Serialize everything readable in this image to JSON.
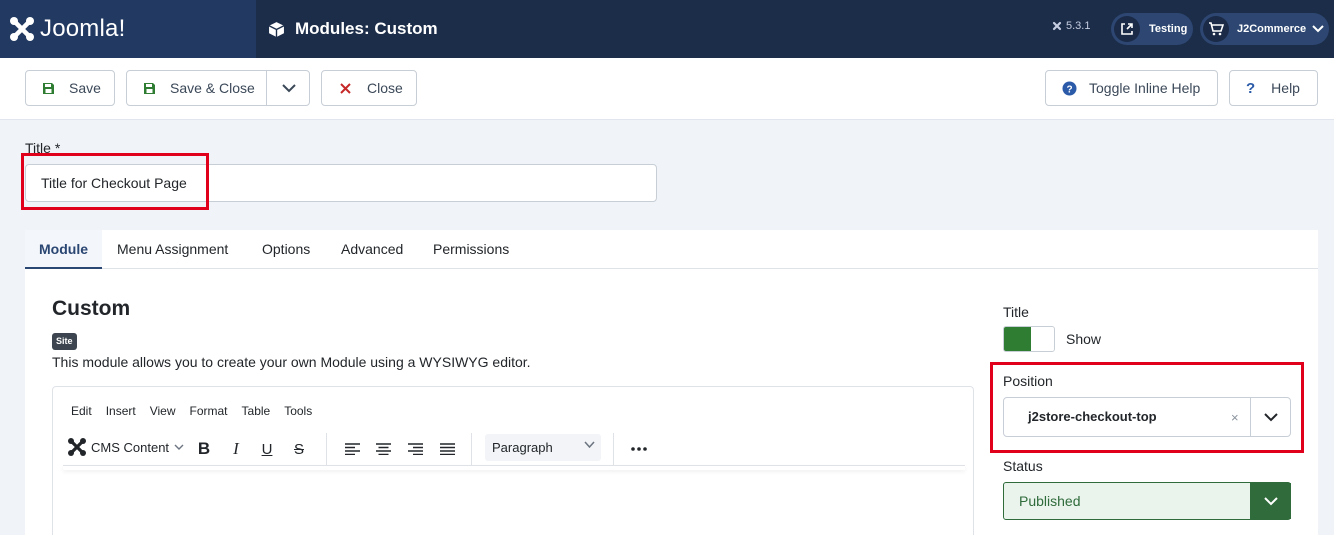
{
  "header": {
    "logo_text": "Joomla!",
    "page_title": "Modules: Custom",
    "version": "5.3.1",
    "site_button": "Testing",
    "user_menu": "J2Commerce"
  },
  "toolbar": {
    "save": "Save",
    "save_close": "Save & Close",
    "close": "Close",
    "toggle_help": "Toggle Inline Help",
    "help": "Help"
  },
  "title_field": {
    "label": "Title *",
    "value": "Title for Checkout Page"
  },
  "tabs": [
    "Module",
    "Menu Assignment",
    "Options",
    "Advanced",
    "Permissions"
  ],
  "module": {
    "name": "Custom",
    "badge": "Site",
    "description": "This module allows you to create your own Module using a WYSIWYG editor."
  },
  "editor": {
    "menu": [
      "Edit",
      "Insert",
      "View",
      "Format",
      "Table",
      "Tools"
    ],
    "cms_content": "CMS Content",
    "paragraph": "Paragraph"
  },
  "sidebar": {
    "title_label": "Title",
    "title_toggle": "Show",
    "position_label": "Position",
    "position_value": "j2store-checkout-top",
    "position_clear": "×",
    "status_label": "Status",
    "status_value": "Published"
  },
  "colors": {
    "header_bg": "#1c2d4a",
    "accent": "#2a4672",
    "highlight": "#e1001b",
    "success": "#2f7d32"
  }
}
